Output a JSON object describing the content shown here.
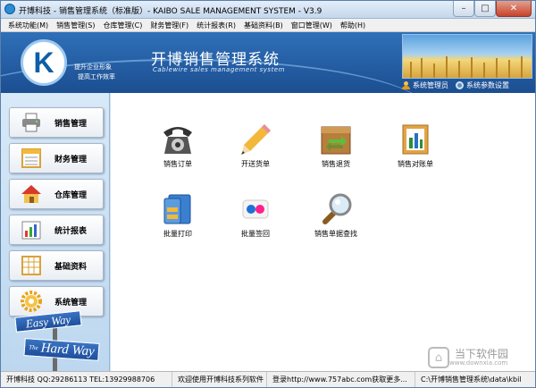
{
  "window": {
    "title": "开博科技 - 销售管理系统（标准版）- KAIBO SALE MANAGEMENT SYSTEM - V3.9",
    "min": "–",
    "max": "□",
    "close": "✕"
  },
  "menu": [
    "系统功能(M)",
    "销售管理(S)",
    "仓库管理(C)",
    "财务管理(F)",
    "统计报表(R)",
    "基础资料(B)",
    "窗口管理(W)",
    "帮助(H)"
  ],
  "header": {
    "logo_letter": "K",
    "slogan_1": "提升企业形象",
    "slogan_2": "提高工作效率",
    "app_title": "开博销售管理系统",
    "app_subtitle": "Cablewire sales management system",
    "user_label": "系统管理员",
    "settings_label": "系统参数设置"
  },
  "sidebar": [
    {
      "label": "销售管理",
      "icon": "printer-icon"
    },
    {
      "label": "财务管理",
      "icon": "ledger-icon"
    },
    {
      "label": "仓库管理",
      "icon": "warehouse-icon"
    },
    {
      "label": "统计报表",
      "icon": "bar-chart-icon"
    },
    {
      "label": "基础资料",
      "icon": "grid-icon"
    },
    {
      "label": "系统管理",
      "icon": "gear-icon"
    }
  ],
  "signs": {
    "easy": "Easy Way",
    "the": "The",
    "hard": "Hard Way"
  },
  "functions": [
    {
      "label": "销售订单",
      "icon": "telephone-icon"
    },
    {
      "label": "开送货单",
      "icon": "pencil-icon"
    },
    {
      "label": "销售退货",
      "icon": "return-box-icon"
    },
    {
      "label": "销售对账单",
      "icon": "statement-book-icon"
    },
    {
      "label": "批量打印",
      "icon": "folder-print-icon"
    },
    {
      "label": "批量签回",
      "icon": "flickr-dots-icon"
    },
    {
      "label": "销售单据查找",
      "icon": "magnifier-icon"
    }
  ],
  "status": {
    "company": "开博科技 QQ:29286113 TEL:13929988706",
    "welcome": "欢迎使用开博科技系列软件",
    "login": "登录http://www.757abc.com获取更多...",
    "path": "C:\\开博销售管理系统\\data\\kbil"
  },
  "watermark": {
    "text": "当下软件园",
    "url": "www.downxia.com"
  },
  "colors": {
    "header_blue": "#1c4e91",
    "sidebar_bg": "#cfe3f3"
  }
}
